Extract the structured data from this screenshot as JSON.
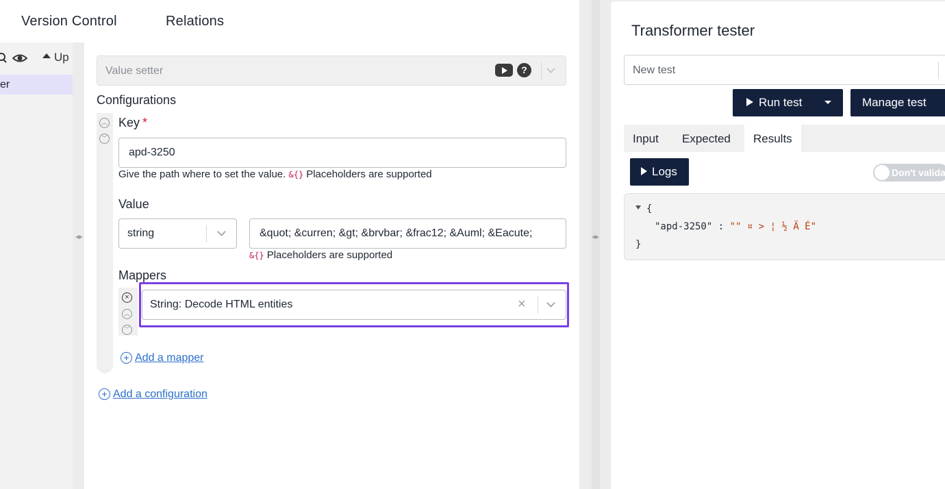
{
  "left_tabs": [
    "Version Control",
    "Relations"
  ],
  "nav": {
    "sort_label": "Up",
    "selected_item": "er"
  },
  "transformer": {
    "name": "Value setter",
    "configurations_title": "Configurations",
    "key": {
      "label": "Key",
      "required_mark": "*",
      "value": "apd-3250",
      "help_text": "Give the path where to set the value.",
      "placeholder_hint": "Placeholders are supported",
      "placeholder_syntax": "&{}"
    },
    "value": {
      "label": "Value",
      "type": "string",
      "value": "&quot; &curren; &gt; &brvbar; &frac12; &Auml; &Eacute;",
      "placeholder_hint": "Placeholders are supported",
      "placeholder_syntax": "&{}"
    },
    "mappers": {
      "label": "Mappers",
      "selected": "String: Decode HTML entities",
      "clear_symbol": "×",
      "add_label": "Add a mapper"
    },
    "add_configuration_label": "Add a configuration"
  },
  "tester": {
    "title": "Transformer tester",
    "test_select": "New test",
    "run_label": "Run test",
    "manage_label": "Manage test",
    "tabs": [
      "Input",
      "Expected",
      "Results"
    ],
    "active_tab": "Results",
    "logs_label": "Logs",
    "toggle_label": "Don't valida",
    "result": {
      "open_brace": "{",
      "key": "\"apd-3250\"",
      "colon": ":",
      "value": "\"\" ¤ > ¦ ½ Ä É\"",
      "close_brace": "}"
    }
  },
  "colors": {
    "accent_highlight": "#7b3fe4",
    "dark_button": "#14213d",
    "link": "#2a6fcb",
    "required": "#d3182d",
    "nav_selected": "#e3e1fa"
  }
}
